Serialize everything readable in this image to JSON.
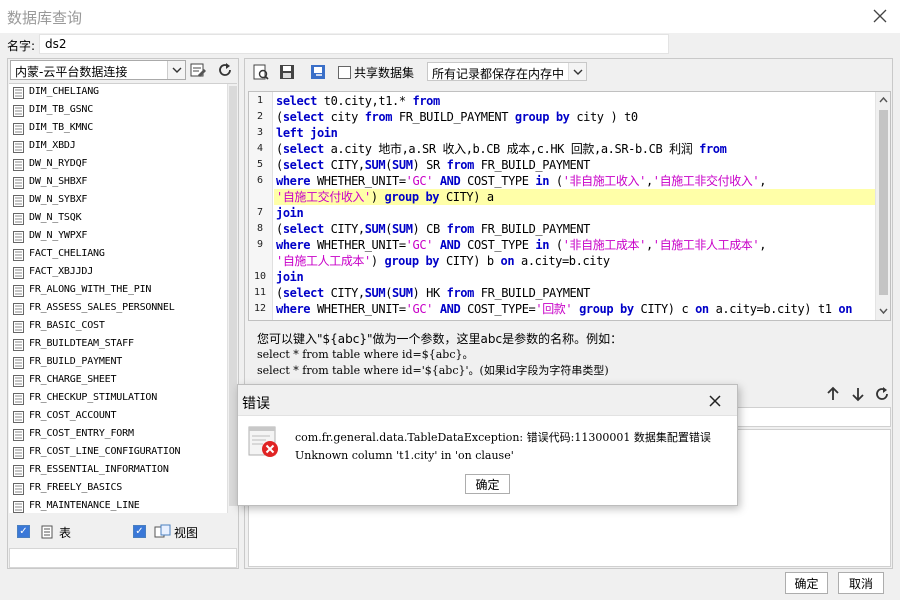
{
  "window": {
    "title": "数据库查询"
  },
  "name_field": {
    "label": "名字:",
    "value": "ds2"
  },
  "left": {
    "datasource": "内蒙-云平台数据连接",
    "tables": [
      "DIM_CHELIANG",
      "DIM_TB_GSNC",
      "DIM_TB_KMNC",
      "DIM_XBDJ",
      "DW_N_RYDQF",
      "DW_N_SHBXF",
      "DW_N_SYBXF",
      "DW_N_TSQK",
      "DW_N_YWPXF",
      "FACT_CHELIANG",
      "FACT_XBJJDJ",
      "FR_ALONG_WITH_THE_PIN",
      "FR_ASSESS_SALES_PERSONNEL",
      "FR_BASIC_COST",
      "FR_BUILDTEAM_STAFF",
      "FR_BUILD_PAYMENT",
      "FR_CHARGE_SHEET",
      "FR_CHECKUP_STIMULATION",
      "FR_COST_ACCOUNT",
      "FR_COST_ENTRY_FORM",
      "FR_COST_LINE_CONFIGURATION",
      "FR_ESSENTIAL_INFORMATION",
      "FR_FREELY_BASICS",
      "FR_MAINTENANCE_LINE"
    ],
    "filter_table_label": "表",
    "filter_view_label": "视图"
  },
  "toolbar": {
    "share_label": "共享数据集",
    "memory_option": "所有记录都保存在内存中"
  },
  "editor": {
    "line_numbers": [
      "1",
      "2",
      "3",
      "4",
      "5",
      "6",
      "",
      "7",
      "8",
      "9",
      "",
      "10",
      "11",
      "12"
    ],
    "lines": [
      [
        [
          "k",
          "select"
        ],
        [
          "t",
          " t0.city,t1.* "
        ],
        [
          "k",
          "from"
        ]
      ],
      [
        [
          "t",
          "("
        ],
        [
          "k",
          "select"
        ],
        [
          "t",
          " city "
        ],
        [
          "k",
          "from"
        ],
        [
          "t",
          " FR_BUILD_PAYMENT "
        ],
        [
          "k",
          "group by"
        ],
        [
          "t",
          " city ) t0"
        ]
      ],
      [
        [
          "k",
          "left join"
        ]
      ],
      [
        [
          "t",
          "("
        ],
        [
          "k",
          "select"
        ],
        [
          "t",
          " a.city 地市,a.SR 收入,b.CB 成本,c.HK 回款,a.SR-b.CB 利润 "
        ],
        [
          "k",
          "from"
        ]
      ],
      [
        [
          "t",
          "("
        ],
        [
          "k",
          "select"
        ],
        [
          "t",
          " CITY,"
        ],
        [
          "k",
          "SUM"
        ],
        [
          "t",
          "("
        ],
        [
          "k",
          "SUM"
        ],
        [
          "t",
          ") SR "
        ],
        [
          "k",
          "from"
        ],
        [
          "t",
          " FR_BUILD_PAYMENT"
        ]
      ],
      [
        [
          "k",
          "where"
        ],
        [
          "t",
          " WHETHER_UNIT="
        ],
        [
          "s",
          "'GC'"
        ],
        [
          "t",
          " "
        ],
        [
          "k",
          "AND"
        ],
        [
          "t",
          " COST_TYPE "
        ],
        [
          "k",
          "in"
        ],
        [
          "t",
          " ("
        ],
        [
          "s",
          "'非自施工收入'"
        ],
        [
          "t",
          ","
        ],
        [
          "s",
          "'自施工非交付收入'"
        ],
        [
          "t",
          ","
        ]
      ],
      [
        [
          "s",
          "'自施工交付收入'"
        ],
        [
          "t",
          ") "
        ],
        [
          "k",
          "group by"
        ],
        [
          "t",
          " CITY) a"
        ]
      ],
      [
        [
          "k",
          "join"
        ]
      ],
      [
        [
          "t",
          "("
        ],
        [
          "k",
          "select"
        ],
        [
          "t",
          " CITY,"
        ],
        [
          "k",
          "SUM"
        ],
        [
          "t",
          "("
        ],
        [
          "k",
          "SUM"
        ],
        [
          "t",
          ") CB "
        ],
        [
          "k",
          "from"
        ],
        [
          "t",
          " FR_BUILD_PAYMENT"
        ]
      ],
      [
        [
          "k",
          "where"
        ],
        [
          "t",
          " WHETHER_UNIT="
        ],
        [
          "s",
          "'GC'"
        ],
        [
          "t",
          " "
        ],
        [
          "k",
          "AND"
        ],
        [
          "t",
          " COST_TYPE "
        ],
        [
          "k",
          "in"
        ],
        [
          "t",
          " ("
        ],
        [
          "s",
          "'非自施工成本'"
        ],
        [
          "t",
          ","
        ],
        [
          "s",
          "'自施工非人工成本'"
        ],
        [
          "t",
          ","
        ]
      ],
      [
        [
          "s",
          "'自施工人工成本'"
        ],
        [
          "t",
          ") "
        ],
        [
          "k",
          "group by"
        ],
        [
          "t",
          " CITY) b "
        ],
        [
          "k",
          "on"
        ],
        [
          "t",
          " a.city=b.city"
        ]
      ],
      [
        [
          "k",
          "join"
        ]
      ],
      [
        [
          "t",
          "("
        ],
        [
          "k",
          "select"
        ],
        [
          "t",
          " CITY,"
        ],
        [
          "k",
          "SUM"
        ],
        [
          "t",
          "("
        ],
        [
          "k",
          "SUM"
        ],
        [
          "t",
          ") HK "
        ],
        [
          "k",
          "from"
        ],
        [
          "t",
          " FR_BUILD_PAYMENT"
        ]
      ],
      [
        [
          "k",
          "where"
        ],
        [
          "t",
          " WHETHER_UNIT="
        ],
        [
          "s",
          "'GC'"
        ],
        [
          "t",
          " "
        ],
        [
          "k",
          "AND"
        ],
        [
          "t",
          " COST_TYPE="
        ],
        [
          "s",
          "'回款'"
        ],
        [
          "t",
          " "
        ],
        [
          "k",
          "group by"
        ],
        [
          "t",
          " CITY) c  "
        ],
        [
          "k",
          "on"
        ],
        [
          "t",
          " a.city=b.city) t1 "
        ],
        [
          "k",
          "on"
        ]
      ]
    ]
  },
  "hint": {
    "line1": "您可以键入\"${abc}\"做为一个参数，这里abc是参数的名称。例如：",
    "line2": "select * from table where id=${abc}。",
    "line3": "select * from table where id='${abc}'。(如果id字段为字符串类型)"
  },
  "buttons": {
    "ok": "确定",
    "cancel": "取消"
  },
  "error_dialog": {
    "title": "错误",
    "message_line1": "com.fr.general.data.TableDataException: 错误代码:11300001 数据集配置错误",
    "message_line2": "Unknown column 't1.city' in 'on clause'",
    "ok": "确定"
  },
  "icons": {
    "window_close": "close-icon",
    "dialog_close": "close-icon",
    "error": "error-icon",
    "refresh": "refresh-icon",
    "arrow_up": "arrow-up-icon",
    "arrow_down": "arrow-down-icon"
  },
  "colors": {
    "keyword": "#0000c8",
    "string": "#c800c8",
    "highlight": "#ffffa8",
    "error_red": "#e02424",
    "checkbox": "#3a78d8"
  }
}
